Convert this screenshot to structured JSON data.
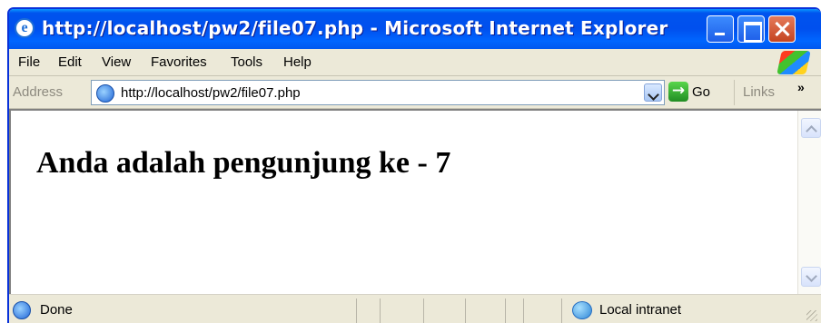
{
  "window": {
    "title": "http://localhost/pw2/file07.php - Microsoft Internet Explorer",
    "title_icon_glyph": "e"
  },
  "menu": {
    "items": [
      "File",
      "Edit",
      "View",
      "Favorites",
      "Tools",
      "Help"
    ]
  },
  "address_bar": {
    "label": "Address",
    "url": "http://localhost/pw2/file07.php",
    "go_label": "Go",
    "go_glyph": "→",
    "links_label": "Links",
    "links_chevron": "»"
  },
  "content": {
    "heading": "Anda adalah pengunjung ke - 7"
  },
  "status_bar": {
    "status": "Done",
    "zone": "Local intranet"
  },
  "icons": {
    "title": "ie-icon",
    "page": "ie-page-icon",
    "go": "go-arrow-icon",
    "zone": "intranet-globe-icon"
  }
}
